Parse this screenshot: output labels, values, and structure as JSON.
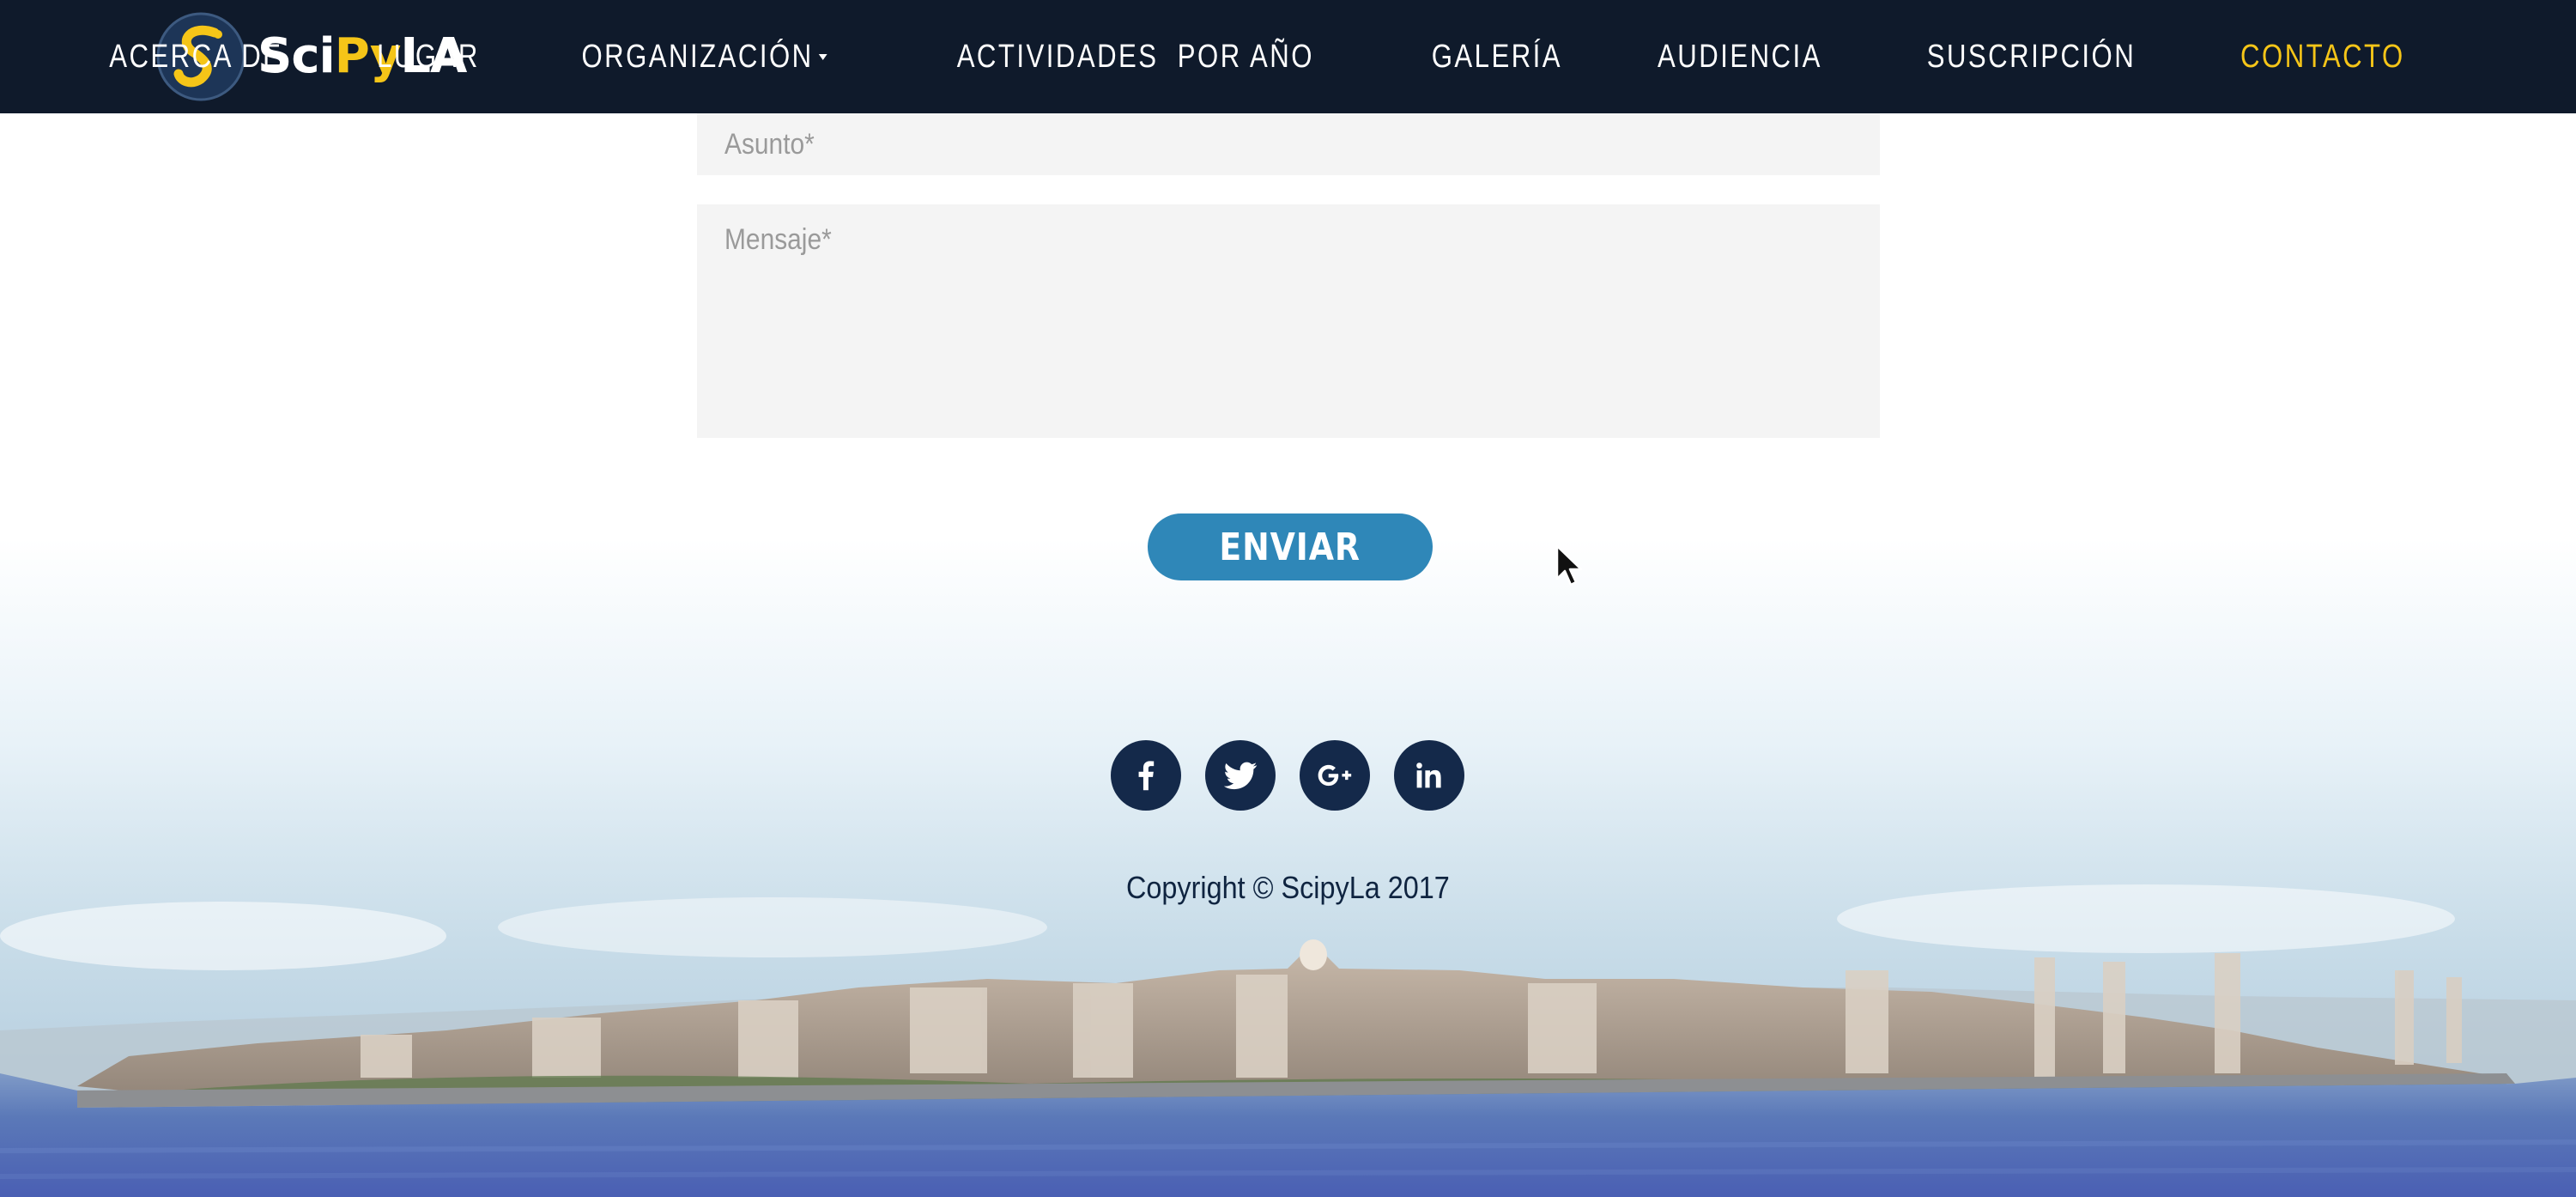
{
  "brand": {
    "part1": "Sci",
    "part2": "Py",
    "part3": "LA"
  },
  "nav": {
    "items": [
      {
        "label": "ACERCA DE"
      },
      {
        "label": "LUGAR"
      },
      {
        "label": "ORGANIZACIÓN"
      },
      {
        "label": "ACTIVIDADES  POR AÑO"
      },
      {
        "label": "GALERÍA"
      },
      {
        "label": "AUDIENCIA"
      },
      {
        "label": "SUSCRIPCIÓN"
      },
      {
        "label": "CONTACTO"
      }
    ],
    "active_color": "#f5c518",
    "background": "#0f1a2b"
  },
  "form": {
    "subject_placeholder": "Asunto*",
    "message_placeholder": "Mensaje*",
    "submit_label": "ENVIAR",
    "button_color": "#2f87b8"
  },
  "social": {
    "icons": [
      "facebook-icon",
      "twitter-icon",
      "google-plus-icon",
      "linkedin-icon"
    ],
    "color": "#14294a"
  },
  "footer": {
    "copyright": "Copyright © ScipyLa 2017"
  }
}
